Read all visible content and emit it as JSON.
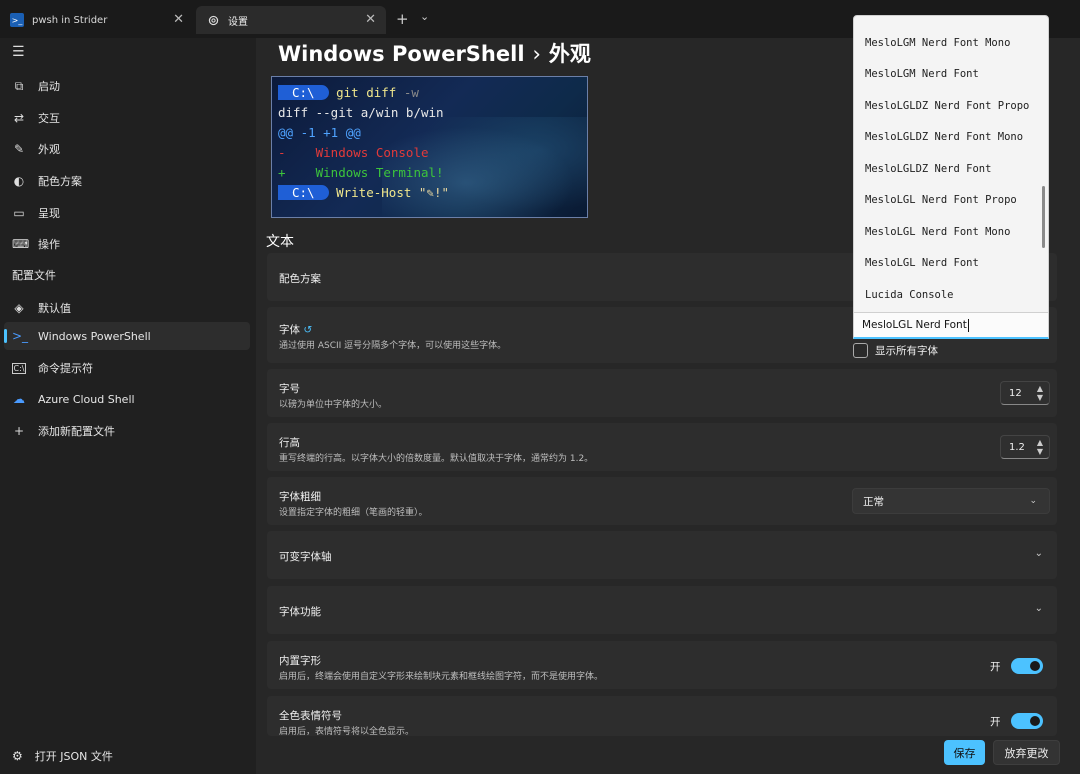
{
  "tabs": [
    {
      "label": "pwsh in Strider",
      "icon": "powershell-icon"
    },
    {
      "label": "设置",
      "icon": "gear-icon"
    }
  ],
  "sidebar": {
    "items": [
      {
        "label": "启动",
        "icon": "launch-icon"
      },
      {
        "label": "交互",
        "icon": "interaction-icon"
      },
      {
        "label": "外观",
        "icon": "brush-icon"
      },
      {
        "label": "配色方案",
        "icon": "palette-icon"
      },
      {
        "label": "呈现",
        "icon": "monitor-icon"
      },
      {
        "label": "操作",
        "icon": "keyboard-icon"
      }
    ],
    "profiles_header": "配置文件",
    "profiles": [
      {
        "label": "默认值",
        "icon": "layers-icon"
      },
      {
        "label": "Windows PowerShell",
        "icon": "powershell-icon"
      },
      {
        "label": "命令提示符",
        "icon": "cmd-icon"
      },
      {
        "label": "Azure Cloud Shell",
        "icon": "azure-icon"
      },
      {
        "label": "添加新配置文件",
        "icon": "plus-icon"
      }
    ],
    "json_link": "打开 JSON 文件"
  },
  "header": {
    "profile": "Windows PowerShell",
    "separator": "›",
    "page": "外观"
  },
  "preview": {
    "line1_prompt": "C:\\",
    "line1_cmd": "git diff",
    "line1_flag": "-w",
    "line2": "diff --git a/win b/win",
    "line3": "@@ -1 +1 @@",
    "line4": "-    Windows Console",
    "line5": "+    Windows Terminal!",
    "line6_prompt": "C:\\",
    "line6_cmd": "Write-Host",
    "line6_str": "\"✎!\""
  },
  "text_section": {
    "title": "文本",
    "color_scheme": {
      "title": "配色方案"
    },
    "font_face": {
      "title": "字体",
      "desc": "通过使用 ASCII 逗号分隔多个字体，可以使用这些字体。",
      "reset_icon": "reset-icon",
      "input_value": "MesloLGL Nerd Font",
      "show_all_label": "显示所有字体",
      "options": [
        "MesloLGM Nerd Font Mono",
        "MesloLGM Nerd Font",
        "MesloLGLDZ Nerd Font Propo",
        "MesloLGLDZ Nerd Font Mono",
        "MesloLGLDZ Nerd Font",
        "MesloLGL Nerd Font Propo",
        "MesloLGL Nerd Font Mono",
        "MesloLGL Nerd Font",
        "Lucida Console"
      ]
    },
    "font_size": {
      "title": "字号",
      "desc": "以磅为单位中字体的大小。",
      "value": "12"
    },
    "line_height": {
      "title": "行高",
      "desc": "重写终端的行高。以字体大小的倍数度量。默认值取决于字体，通常约为 1.2。",
      "value": "1.2"
    },
    "font_weight": {
      "title": "字体粗细",
      "desc": "设置指定字体的粗细（笔画的轻重）。",
      "value": "正常"
    },
    "variable_axes": {
      "title": "可变字体轴"
    },
    "font_features": {
      "title": "字体功能"
    },
    "builtin_glyphs": {
      "title": "内置字形",
      "desc": "启用后，终端会使用自定义字形来绘制块元素和框线绘图字符，而不是使用字体。",
      "toggle_label": "开"
    },
    "color_emoji": {
      "title": "全色表情符号",
      "desc": "启用后，表情符号将以全色显示。",
      "toggle_label": "开"
    }
  },
  "footer": {
    "save": "保存",
    "discard": "放弃更改"
  },
  "colors": {
    "accent": "#4cc2ff",
    "background": "#202020",
    "card": "#2d2d2d"
  }
}
